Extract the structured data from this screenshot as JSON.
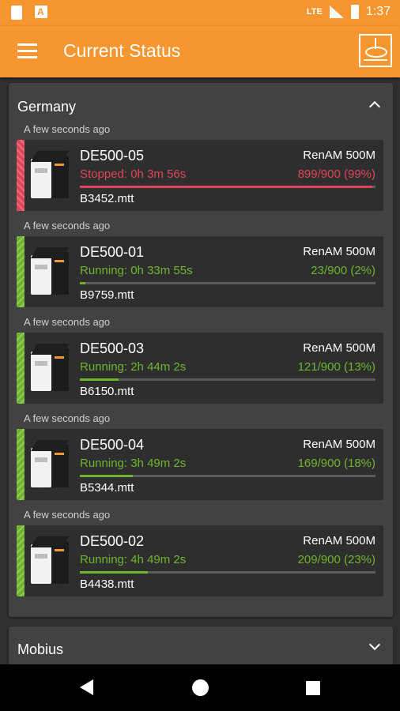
{
  "status_bar": {
    "time": "1:37",
    "signal": "LTE"
  },
  "app_bar": {
    "title": "Current Status"
  },
  "groups": [
    {
      "name": "Germany",
      "expanded": true,
      "machines": [
        {
          "updated": "A few seconds ago",
          "name": "DE500-05",
          "model": "RenAM 500M",
          "status": "Stopped: 0h 3m 56s",
          "state": "stopped",
          "progress_text": "899/900 (99%)",
          "progress": 0.99,
          "file": "B3452.mtt"
        },
        {
          "updated": "A few seconds ago",
          "name": "DE500-01",
          "model": "RenAM 500M",
          "status": "Running: 0h 33m 55s",
          "state": "running",
          "progress_text": "23/900 (2%)",
          "progress": 0.02,
          "file": "B9759.mtt"
        },
        {
          "updated": "A few seconds ago",
          "name": "DE500-03",
          "model": "RenAM 500M",
          "status": "Running: 2h 44m 2s",
          "state": "running",
          "progress_text": "121/900 (13%)",
          "progress": 0.13,
          "file": "B6150.mtt"
        },
        {
          "updated": "A few seconds ago",
          "name": "DE500-04",
          "model": "RenAM 500M",
          "status": "Running: 3h 49m 2s",
          "state": "running",
          "progress_text": "169/900 (18%)",
          "progress": 0.18,
          "file": "B5344.mtt"
        },
        {
          "updated": "A few seconds ago",
          "name": "DE500-02",
          "model": "RenAM 500M",
          "status": "Running: 4h 49m 2s",
          "state": "running",
          "progress_text": "209/900 (23%)",
          "progress": 0.23,
          "file": "B4438.mtt"
        }
      ]
    },
    {
      "name": "Mobius",
      "expanded": false,
      "machines": []
    }
  ],
  "colors": {
    "accent": "#F7962E",
    "stopped": "#E0455A",
    "running": "#6FB52C"
  }
}
